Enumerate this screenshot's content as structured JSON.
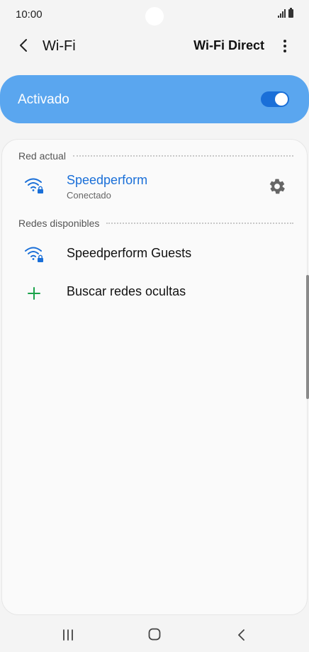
{
  "status_bar": {
    "time": "10:00"
  },
  "app_bar": {
    "title": "Wi-Fi",
    "wifi_direct_label": "Wi-Fi Direct"
  },
  "toggle": {
    "label": "Activado",
    "state": "on"
  },
  "current_network": {
    "section_label": "Red actual",
    "name": "Speedperform",
    "status": "Conectado"
  },
  "available_networks": {
    "section_label": "Redes disponibles",
    "items": [
      {
        "name": "Speedperform Guests"
      }
    ]
  },
  "hidden_networks": {
    "label": "Buscar redes ocultas"
  },
  "colors": {
    "accent": "#1a6fd8",
    "toggle_card": "#5aa6ef",
    "add_icon": "#1aa34a"
  },
  "icons": {
    "back": "chevron-left-icon",
    "more": "more-vert-icon",
    "wifi": "wifi-lock-icon",
    "settings": "gear-icon",
    "add": "plus-icon"
  }
}
